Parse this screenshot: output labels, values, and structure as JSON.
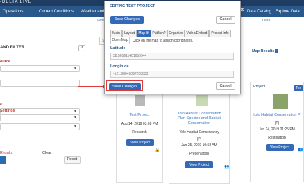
{
  "header": {
    "brand": "-DELTA LIVE",
    "nav": [
      "Operations",
      "Current Conditions",
      "Weather and T",
      "Data Catalog",
      "Explore Data"
    ],
    "subnav": [
      "What",
      "Data"
    ]
  },
  "sidebar": {
    "title": "AND FILTER",
    "help": "?",
    "labels": [
      "ource",
      "e",
      "Settings"
    ],
    "results_label": "Results",
    "clear_label": "Clear",
    "reset_label": "Reset"
  },
  "main": {
    "search_label": "Se",
    "map_results_label": "Map Results",
    "cards": [
      {
        "title": "Test Project",
        "date": "Aug 14, 2019 03:08 PM",
        "category": "Research",
        "button": "View Project"
      },
      {
        "title": "Yolo Habitat Conservation Plan Species and Habitat Conservation",
        "org": "Yolo Habitat Conservancy",
        "role": "(P)",
        "date": "Jun 25, 2019 10:58 AM",
        "category": "Preservation",
        "button": "View Project"
      },
      {
        "type": "Project",
        "tag": "Tes",
        "title": "Yolo Habitat Conservation Pl",
        "role": "(P)",
        "date": "Jun 24, 2019 01:25 PM",
        "category": "Restoration",
        "button": "View Project"
      }
    ]
  },
  "modal": {
    "title": "EDITING TEST PROJECT",
    "save_label": "Save Changes",
    "cancel_label": "Cancel",
    "tabs": [
      "Main",
      "Layout",
      "Map It!",
      "Publish?",
      "Organize",
      "Video/Embed",
      "Project Info"
    ],
    "active_tab": "Map It!",
    "open_map_label": "Open Map",
    "hint": "Click on the map to assign coordinates.",
    "latitude_label": "Latitude",
    "latitude_value": "38.565911401659944",
    "longitude_label": "Longitude",
    "longitude_value": "-121.68049097258833",
    "save_bottom_label": "Save Changes",
    "cancel_bottom_label": "Cancel"
  },
  "colors": {
    "topbar": "#1f3d63",
    "navbar": "#2b588a",
    "primary_button": "#3369b6",
    "annotation_red": "#e03a3a",
    "link": "#3a78c2"
  }
}
